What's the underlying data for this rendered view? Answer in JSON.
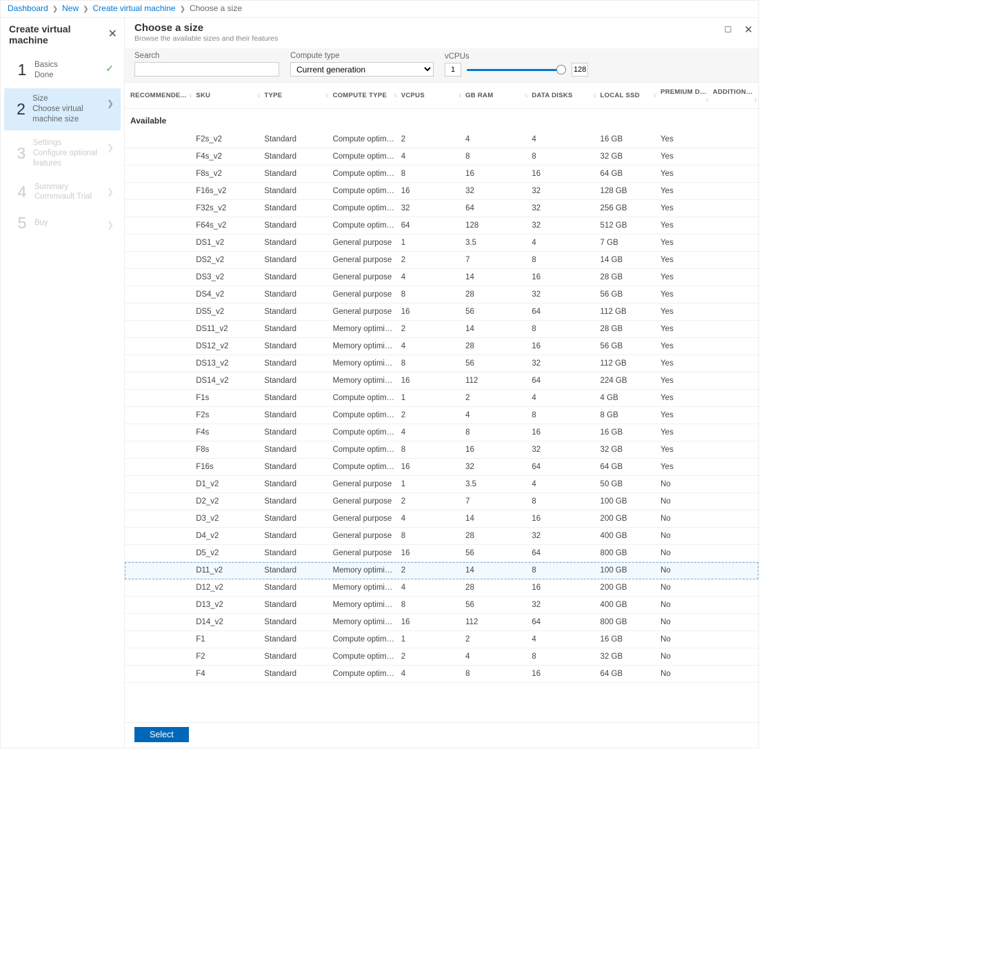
{
  "breadcrumb": {
    "items": [
      "Dashboard",
      "New",
      "Create virtual machine"
    ],
    "current": "Choose a size"
  },
  "wizard": {
    "title": "Create virtual machine",
    "steps": [
      {
        "n": "1",
        "t": "Basics",
        "s": "Done",
        "state": "done"
      },
      {
        "n": "2",
        "t": "Size",
        "s": "Choose virtual machine size",
        "state": "active"
      },
      {
        "n": "3",
        "t": "Settings",
        "s": "Configure optional features",
        "state": "disabled"
      },
      {
        "n": "4",
        "t": "Summary",
        "s": "Commvault Trial",
        "state": "disabled"
      },
      {
        "n": "5",
        "t": "Buy",
        "s": "",
        "state": "disabled"
      }
    ]
  },
  "detail": {
    "title": "Choose a size",
    "subtitle": "Browse the available sizes and their features",
    "filters": {
      "search_label": "Search",
      "search_value": "",
      "compute_type_label": "Compute type",
      "compute_type_value": "Current generation",
      "vcpus_label": "vCPUs",
      "vcpus_min": "1",
      "vcpus_max": "128"
    },
    "columns": [
      "RECOMMENDE...",
      "SKU",
      "TYPE",
      "COMPUTE TYPE",
      "VCPUS",
      "GB RAM",
      "DATA DISKS",
      "LOCAL SSD",
      "PREMIUM DIS...",
      "ADDITIONAL F..."
    ],
    "group_label": "Available",
    "rows": [
      {
        "sku": "F2s_v2",
        "type": "Standard",
        "ctype": "Compute optimized",
        "vcpus": "2",
        "ram": "4",
        "dd": "4",
        "ssd": "16 GB",
        "prem": "Yes"
      },
      {
        "sku": "F4s_v2",
        "type": "Standard",
        "ctype": "Compute optimized",
        "vcpus": "4",
        "ram": "8",
        "dd": "8",
        "ssd": "32 GB",
        "prem": "Yes"
      },
      {
        "sku": "F8s_v2",
        "type": "Standard",
        "ctype": "Compute optimized",
        "vcpus": "8",
        "ram": "16",
        "dd": "16",
        "ssd": "64 GB",
        "prem": "Yes"
      },
      {
        "sku": "F16s_v2",
        "type": "Standard",
        "ctype": "Compute optimized",
        "vcpus": "16",
        "ram": "32",
        "dd": "32",
        "ssd": "128 GB",
        "prem": "Yes"
      },
      {
        "sku": "F32s_v2",
        "type": "Standard",
        "ctype": "Compute optimized",
        "vcpus": "32",
        "ram": "64",
        "dd": "32",
        "ssd": "256 GB",
        "prem": "Yes"
      },
      {
        "sku": "F64s_v2",
        "type": "Standard",
        "ctype": "Compute optimized",
        "vcpus": "64",
        "ram": "128",
        "dd": "32",
        "ssd": "512 GB",
        "prem": "Yes"
      },
      {
        "sku": "DS1_v2",
        "type": "Standard",
        "ctype": "General purpose",
        "vcpus": "1",
        "ram": "3.5",
        "dd": "4",
        "ssd": "7 GB",
        "prem": "Yes"
      },
      {
        "sku": "DS2_v2",
        "type": "Standard",
        "ctype": "General purpose",
        "vcpus": "2",
        "ram": "7",
        "dd": "8",
        "ssd": "14 GB",
        "prem": "Yes"
      },
      {
        "sku": "DS3_v2",
        "type": "Standard",
        "ctype": "General purpose",
        "vcpus": "4",
        "ram": "14",
        "dd": "16",
        "ssd": "28 GB",
        "prem": "Yes"
      },
      {
        "sku": "DS4_v2",
        "type": "Standard",
        "ctype": "General purpose",
        "vcpus": "8",
        "ram": "28",
        "dd": "32",
        "ssd": "56 GB",
        "prem": "Yes"
      },
      {
        "sku": "DS5_v2",
        "type": "Standard",
        "ctype": "General purpose",
        "vcpus": "16",
        "ram": "56",
        "dd": "64",
        "ssd": "112 GB",
        "prem": "Yes"
      },
      {
        "sku": "DS11_v2",
        "type": "Standard",
        "ctype": "Memory optimized",
        "vcpus": "2",
        "ram": "14",
        "dd": "8",
        "ssd": "28 GB",
        "prem": "Yes"
      },
      {
        "sku": "DS12_v2",
        "type": "Standard",
        "ctype": "Memory optimized",
        "vcpus": "4",
        "ram": "28",
        "dd": "16",
        "ssd": "56 GB",
        "prem": "Yes"
      },
      {
        "sku": "DS13_v2",
        "type": "Standard",
        "ctype": "Memory optimized",
        "vcpus": "8",
        "ram": "56",
        "dd": "32",
        "ssd": "112 GB",
        "prem": "Yes"
      },
      {
        "sku": "DS14_v2",
        "type": "Standard",
        "ctype": "Memory optimized",
        "vcpus": "16",
        "ram": "112",
        "dd": "64",
        "ssd": "224 GB",
        "prem": "Yes"
      },
      {
        "sku": "F1s",
        "type": "Standard",
        "ctype": "Compute optimized",
        "vcpus": "1",
        "ram": "2",
        "dd": "4",
        "ssd": "4 GB",
        "prem": "Yes"
      },
      {
        "sku": "F2s",
        "type": "Standard",
        "ctype": "Compute optimized",
        "vcpus": "2",
        "ram": "4",
        "dd": "8",
        "ssd": "8 GB",
        "prem": "Yes"
      },
      {
        "sku": "F4s",
        "type": "Standard",
        "ctype": "Compute optimized",
        "vcpus": "4",
        "ram": "8",
        "dd": "16",
        "ssd": "16 GB",
        "prem": "Yes"
      },
      {
        "sku": "F8s",
        "type": "Standard",
        "ctype": "Compute optimized",
        "vcpus": "8",
        "ram": "16",
        "dd": "32",
        "ssd": "32 GB",
        "prem": "Yes"
      },
      {
        "sku": "F16s",
        "type": "Standard",
        "ctype": "Compute optimized",
        "vcpus": "16",
        "ram": "32",
        "dd": "64",
        "ssd": "64 GB",
        "prem": "Yes"
      },
      {
        "sku": "D1_v2",
        "type": "Standard",
        "ctype": "General purpose",
        "vcpus": "1",
        "ram": "3.5",
        "dd": "4",
        "ssd": "50 GB",
        "prem": "No"
      },
      {
        "sku": "D2_v2",
        "type": "Standard",
        "ctype": "General purpose",
        "vcpus": "2",
        "ram": "7",
        "dd": "8",
        "ssd": "100 GB",
        "prem": "No"
      },
      {
        "sku": "D3_v2",
        "type": "Standard",
        "ctype": "General purpose",
        "vcpus": "4",
        "ram": "14",
        "dd": "16",
        "ssd": "200 GB",
        "prem": "No"
      },
      {
        "sku": "D4_v2",
        "type": "Standard",
        "ctype": "General purpose",
        "vcpus": "8",
        "ram": "28",
        "dd": "32",
        "ssd": "400 GB",
        "prem": "No"
      },
      {
        "sku": "D5_v2",
        "type": "Standard",
        "ctype": "General purpose",
        "vcpus": "16",
        "ram": "56",
        "dd": "64",
        "ssd": "800 GB",
        "prem": "No"
      },
      {
        "sku": "D11_v2",
        "type": "Standard",
        "ctype": "Memory optimized",
        "vcpus": "2",
        "ram": "14",
        "dd": "8",
        "ssd": "100 GB",
        "prem": "No",
        "selected": true
      },
      {
        "sku": "D12_v2",
        "type": "Standard",
        "ctype": "Memory optimized",
        "vcpus": "4",
        "ram": "28",
        "dd": "16",
        "ssd": "200 GB",
        "prem": "No"
      },
      {
        "sku": "D13_v2",
        "type": "Standard",
        "ctype": "Memory optimized",
        "vcpus": "8",
        "ram": "56",
        "dd": "32",
        "ssd": "400 GB",
        "prem": "No"
      },
      {
        "sku": "D14_v2",
        "type": "Standard",
        "ctype": "Memory optimized",
        "vcpus": "16",
        "ram": "112",
        "dd": "64",
        "ssd": "800 GB",
        "prem": "No"
      },
      {
        "sku": "F1",
        "type": "Standard",
        "ctype": "Compute optimized",
        "vcpus": "1",
        "ram": "2",
        "dd": "4",
        "ssd": "16 GB",
        "prem": "No"
      },
      {
        "sku": "F2",
        "type": "Standard",
        "ctype": "Compute optimized",
        "vcpus": "2",
        "ram": "4",
        "dd": "8",
        "ssd": "32 GB",
        "prem": "No"
      },
      {
        "sku": "F4",
        "type": "Standard",
        "ctype": "Compute optimized",
        "vcpus": "4",
        "ram": "8",
        "dd": "16",
        "ssd": "64 GB",
        "prem": "No"
      }
    ],
    "select_button": "Select"
  }
}
